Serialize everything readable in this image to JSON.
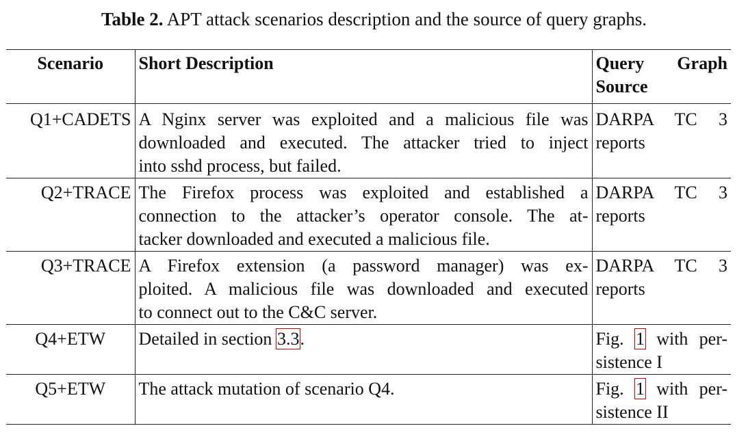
{
  "caption": {
    "label": "Table 2.",
    "text": "APT attack scenarios description and the source of query graphs."
  },
  "headers": {
    "scenario": "Scenario",
    "description": "Short Description",
    "source_line1": "Query Graph",
    "source_line2": "Source"
  },
  "rows": [
    {
      "scenario": "Q1+CADETS",
      "desc_lines": [
        "A Nginx server was exploited and a malicious file was",
        "downloaded and executed. The attacker tried to inject",
        "into sshd process, but failed."
      ],
      "source_lines": [
        "DARPA TC 3",
        "reports"
      ]
    },
    {
      "scenario": "Q2+TRACE",
      "desc_lines": [
        "The Firefox process was exploited and established a",
        "connection to the attacker’s operator console. The at-",
        "tacker downloaded and executed a malicious file."
      ],
      "source_lines": [
        "DARPA TC 3",
        "reports"
      ]
    },
    {
      "scenario": "Q3+TRACE",
      "desc_lines": [
        "A Firefox extension (a password manager) was ex-",
        "ploited. A malicious file was downloaded and executed",
        "to connect out to the C&C server."
      ],
      "source_lines": [
        "DARPA TC 3",
        "reports"
      ]
    },
    {
      "scenario": "Q4+ETW",
      "desc_prefix": "Detailed in section ",
      "desc_ref": "3.3",
      "desc_suffix": ".",
      "source_prefix": "Fig. ",
      "source_ref": "1",
      "source_suffix": " with per-",
      "source_line2": "sistence I"
    },
    {
      "scenario": "Q5+ETW",
      "desc_text": "The attack mutation of scenario Q4.",
      "source_prefix": "Fig. ",
      "source_ref": "1",
      "source_suffix": " with per-",
      "source_line2": "sistence II"
    }
  ]
}
